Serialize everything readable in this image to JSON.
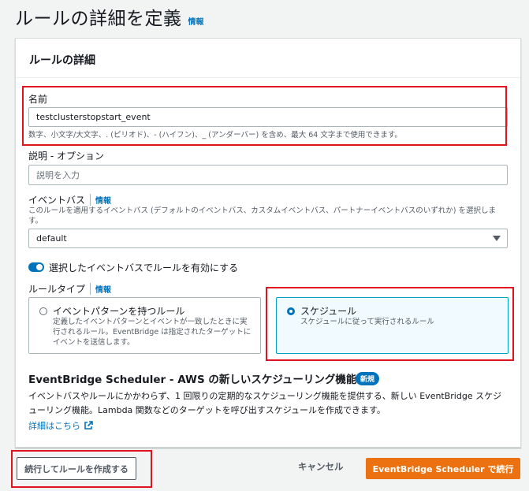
{
  "page": {
    "title": "ルールの詳細を定義",
    "info": "情報"
  },
  "panel": {
    "title": "ルールの詳細"
  },
  "name_field": {
    "label": "名前",
    "value": "testclusterstopstart_event",
    "hint": "数字、小文字/大文字、. (ピリオド)、- (ハイフン)、_ (アンダーバー) を含め、最大 64 文字まで使用できます。"
  },
  "description_field": {
    "label": "説明 - オプション",
    "placeholder": "説明を入力"
  },
  "event_bus": {
    "label": "イベントバス",
    "info": "情報",
    "hint": "このルールを適用するイベントバス (デフォルトのイベントバス、カスタムイベントバス、パートナーイベントバスのいずれか) を選択します。",
    "selected": "default"
  },
  "toggle": {
    "label": "選択したイベントバスでルールを有効にする",
    "enabled": true
  },
  "rule_type": {
    "label": "ルールタイプ",
    "info": "情報",
    "options": [
      {
        "title": "イベントパターンを持つルール",
        "description": "定義したイベントパターンとイベントが一致したときに実行されるルール。EventBridge は指定されたターゲットにイベントを送信します。",
        "selected": false
      },
      {
        "title": "スケジュール",
        "description": "スケジュールに従って実行されるルール",
        "selected": true
      }
    ]
  },
  "scheduler_notice": {
    "title": "EventBridge Scheduler - AWS の新しいスケジューリング機能!",
    "badge": "新規",
    "body": "イベントバスやルールにかかわらず、1 回限りの定期的なスケジューリング機能を提供する、新しい EventBridge スケジューリング機能。Lambda 関数などのターゲットを呼び出すスケジュールを作成できます。",
    "link": "詳細はこちら"
  },
  "footer": {
    "continue_rule": "続行してルールを作成する",
    "cancel": "キャンセル",
    "continue_scheduler": "EventBridge Scheduler で続行"
  },
  "colors": {
    "primary": "#ec7211",
    "link": "#0073bb",
    "highlight": "#e0131f"
  }
}
